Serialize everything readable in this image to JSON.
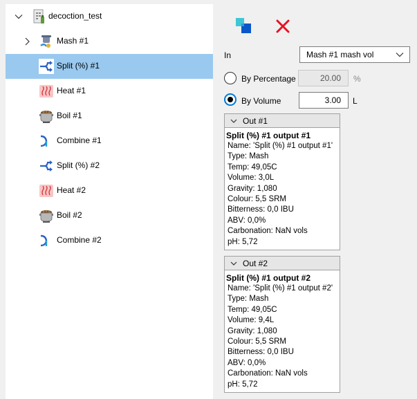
{
  "tree": {
    "root": {
      "label": "decoction_test",
      "expanded": true
    },
    "items": [
      {
        "label": "Mash #1",
        "icon": "mash-icon",
        "has_children": true,
        "selected": false
      },
      {
        "label": "Split (%) #1",
        "icon": "split-icon",
        "has_children": false,
        "selected": true
      },
      {
        "label": "Heat #1",
        "icon": "heat-icon",
        "has_children": false,
        "selected": false
      },
      {
        "label": "Boil #1",
        "icon": "boil-icon",
        "has_children": false,
        "selected": false
      },
      {
        "label": "Combine #1",
        "icon": "combine-icon",
        "has_children": false,
        "selected": false
      },
      {
        "label": "Split (%) #2",
        "icon": "split-icon",
        "has_children": false,
        "selected": false
      },
      {
        "label": "Heat #2",
        "icon": "heat-icon",
        "has_children": false,
        "selected": false
      },
      {
        "label": "Boil #2",
        "icon": "boil-icon",
        "has_children": false,
        "selected": false
      },
      {
        "label": "Combine #2",
        "icon": "combine-icon",
        "has_children": false,
        "selected": false
      }
    ]
  },
  "toolbar": {
    "duplicate_icon": "duplicate-icon",
    "delete_icon": "delete-x-icon",
    "delete_color": "#e81123",
    "accent_color": "#0078d7"
  },
  "panel": {
    "in_label": "In",
    "in_value": "Mash #1 mash vol",
    "by_percentage_label": "By Percentage",
    "percentage_value": "20.00",
    "percentage_unit": "%",
    "by_volume_label": "By Volume",
    "volume_value": "3.00",
    "volume_unit": "L",
    "selected_mode": "By Volume"
  },
  "outputs": [
    {
      "header": "Out #1",
      "title": "Split (%) #1 output #1",
      "lines": [
        "Name: 'Split (%) #1 output #1'",
        "Type: Mash",
        "Temp: 49,05C",
        "Volume: 3,0L",
        "Gravity: 1,080",
        "Colour: 5,5 SRM",
        "Bitterness: 0,0 IBU",
        "ABV: 0,0%",
        "Carbonation: NaN vols",
        "pH: 5,72"
      ]
    },
    {
      "header": "Out #2",
      "title": "Split (%) #1 output #2",
      "lines": [
        "Name: 'Split (%) #1 output #2'",
        "Type: Mash",
        "Temp: 49,05C",
        "Volume: 9,4L",
        "Gravity: 1,080",
        "Colour: 5,5 SRM",
        "Bitterness: 0,0 IBU",
        "ABV: 0,0%",
        "Carbonation: NaN vols",
        "pH: 5,72"
      ]
    }
  ]
}
